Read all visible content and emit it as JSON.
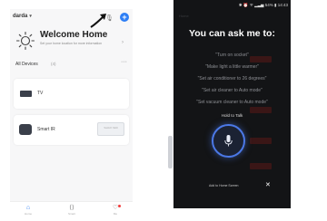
{
  "left_app": {
    "home_name": "darda",
    "welcome": {
      "title": "Welcome Home",
      "subtitle": "Set your home location for more information"
    },
    "devices_label": "All Devices",
    "devices_filter": "(4)",
    "devices": [
      {
        "name": "TV"
      },
      {
        "name": "Smart IR",
        "chip_text": "Switch Skill"
      }
    ],
    "nav": [
      {
        "label": "Home"
      },
      {
        "label": "Smart"
      },
      {
        "label": "Me"
      }
    ]
  },
  "right_app": {
    "status": "✱ ⏰ ᯤ ▂▃▅ 54% ▮ 14:43",
    "ghost_title": "Home",
    "title": "You can ask me to:",
    "suggestions": [
      "\"Turn on socket\"",
      "\"Make light a little warmer\"",
      "\"Set air conditioner to 26 degrees\"",
      "\"Set air cleaner to Auto mode\"",
      "\"Set vacuum cleaner to Auto mode\""
    ],
    "hold_label": "Hold to Talk",
    "add_label": "Add to Home Screen",
    "close_label": "✕"
  },
  "colors": {
    "accent": "#2d7ef5",
    "dark_bg": "#131416",
    "mic_ring": "#4b78e6"
  },
  "icons": [
    "caret-down-icon",
    "mic-icon",
    "plus-icon",
    "sun-icon",
    "more-icon",
    "tv-icon",
    "ir-remote-icon",
    "home-icon",
    "smart-icon",
    "me-icon",
    "close-icon"
  ]
}
